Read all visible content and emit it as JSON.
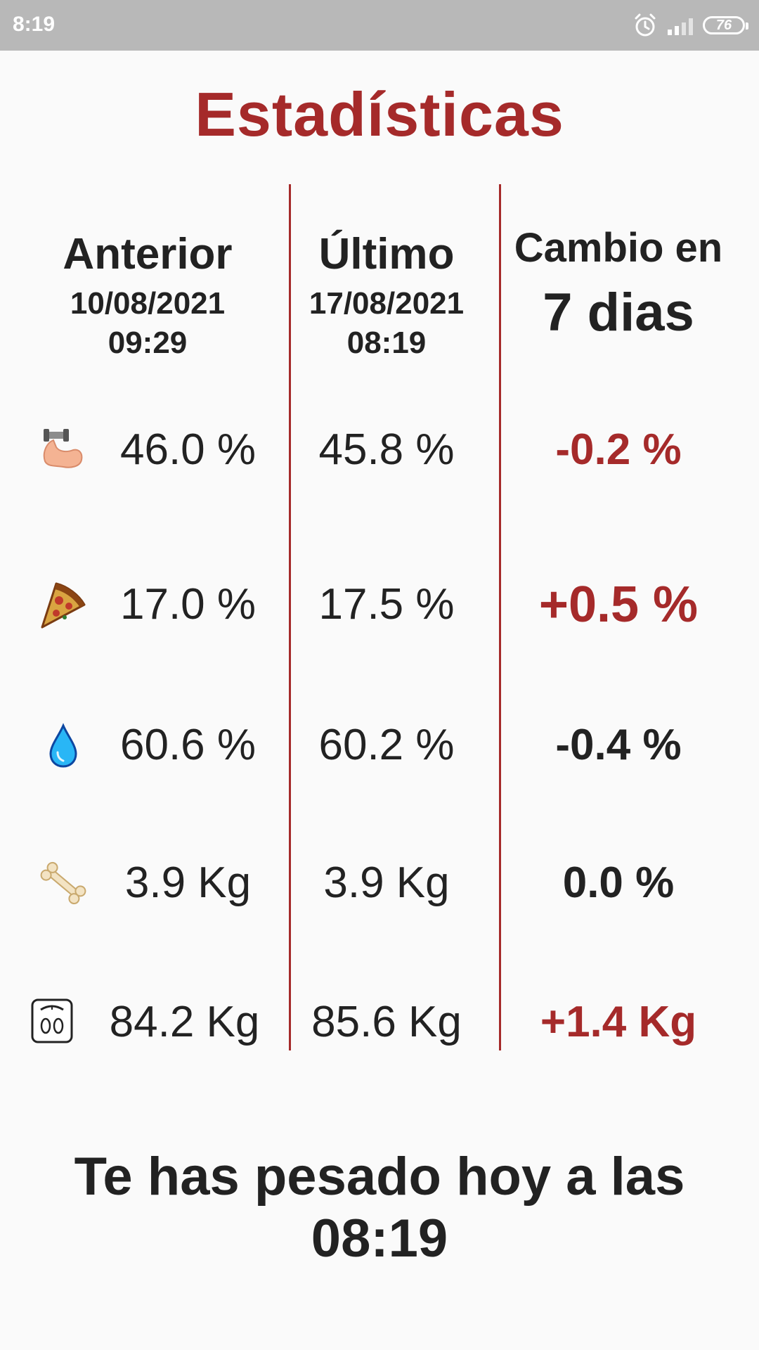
{
  "status_bar": {
    "time": "8:19",
    "battery": "76",
    "icons": [
      "alarm-icon",
      "signal-icon",
      "battery-icon"
    ]
  },
  "title": "Estadísticas",
  "columns": {
    "previous": {
      "label": "Anterior",
      "date": "10/08/2021",
      "time": "09:29"
    },
    "latest": {
      "label": "Último",
      "date": "17/08/2021",
      "time": "08:19"
    },
    "change": {
      "label": "Cambio en",
      "days": "7 dias"
    }
  },
  "rows": [
    {
      "icon": "muscle-icon",
      "previous": "46.0 %",
      "latest": "45.8 %",
      "change": "-0.2 %",
      "change_color": "#a52a2a"
    },
    {
      "icon": "pizza-icon",
      "previous": "17.0 %",
      "latest": "17.5 %",
      "change": "+0.5 %",
      "change_color": "#a52a2a"
    },
    {
      "icon": "water-drop-icon",
      "previous": "60.6 %",
      "latest": "60.2 %",
      "change": "-0.4 %",
      "change_color": "#222222"
    },
    {
      "icon": "bone-icon",
      "previous": "3.9 Kg",
      "latest": "3.9 Kg",
      "change": "0.0 %",
      "change_color": "#222222"
    },
    {
      "icon": "scale-icon",
      "previous": "84.2 Kg",
      "latest": "85.6 Kg",
      "change": "+1.4 Kg",
      "change_color": "#a52a2a"
    }
  ],
  "footer": {
    "line1": "Te has pesado hoy a las",
    "line2": "08:19"
  },
  "colors": {
    "accent": "#a52a2a",
    "text": "#222222",
    "background": "#fafafa",
    "status_bar": "#b8b8b8"
  }
}
